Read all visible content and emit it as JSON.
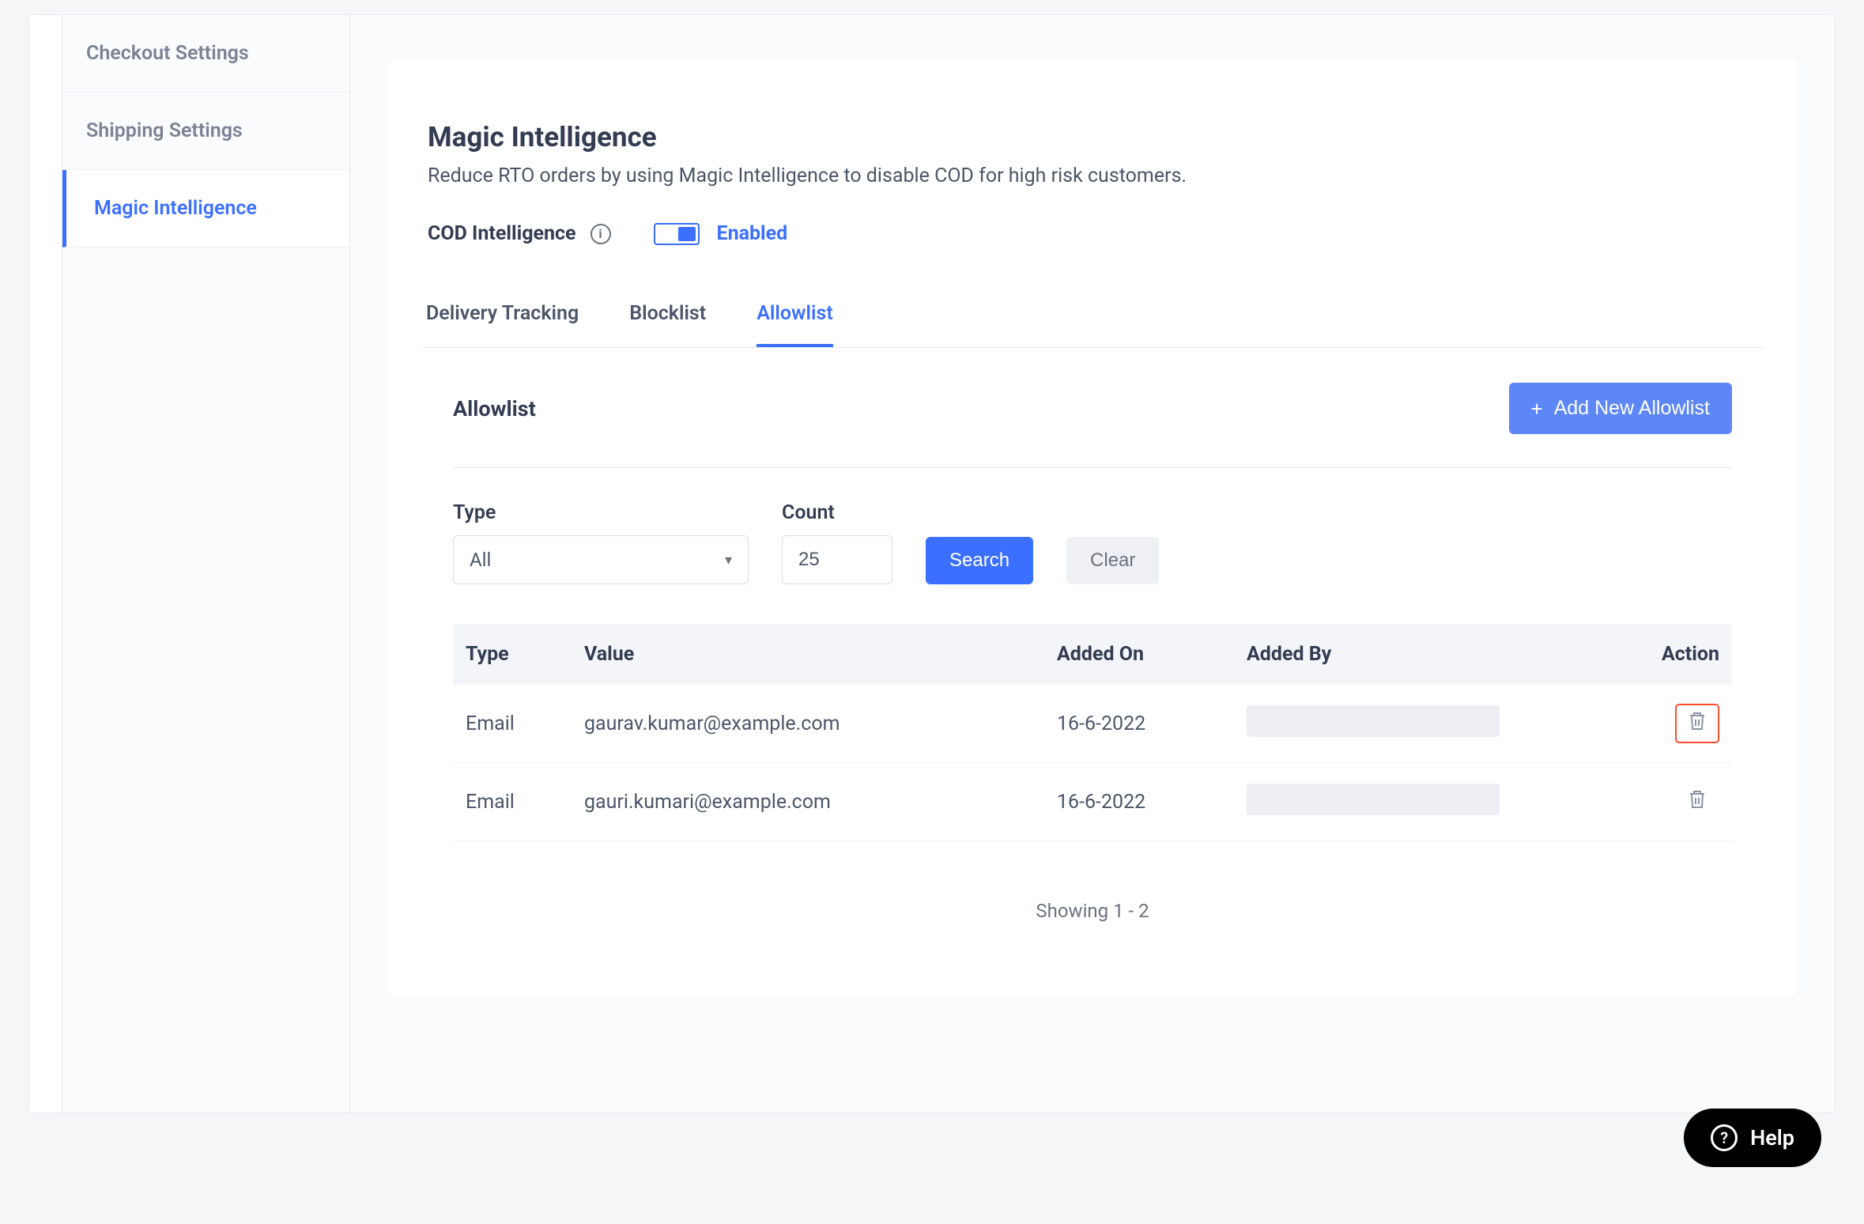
{
  "sidebar": {
    "items": [
      {
        "label": "Checkout Settings"
      },
      {
        "label": "Shipping Settings"
      },
      {
        "label": "Magic Intelligence"
      }
    ]
  },
  "page": {
    "title": "Magic Intelligence",
    "description": "Reduce RTO orders by using Magic Intelligence to disable COD for high risk customers."
  },
  "cod": {
    "label": "COD Intelligence",
    "status": "Enabled"
  },
  "tabs": [
    {
      "label": "Delivery Tracking"
    },
    {
      "label": "Blocklist"
    },
    {
      "label": "Allowlist"
    }
  ],
  "section": {
    "title": "Allowlist",
    "add_button": "Add New Allowlist"
  },
  "filters": {
    "type_label": "Type",
    "type_value": "All",
    "count_label": "Count",
    "count_value": "25",
    "search": "Search",
    "clear": "Clear"
  },
  "table": {
    "headers": {
      "type": "Type",
      "value": "Value",
      "added_on": "Added On",
      "added_by": "Added By",
      "action": "Action"
    },
    "rows": [
      {
        "type": "Email",
        "value": "gaurav.kumar@example.com",
        "added_on": "16-6-2022"
      },
      {
        "type": "Email",
        "value": "gauri.kumari@example.com",
        "added_on": "16-6-2022"
      }
    ],
    "pagination": "Showing 1 - 2"
  },
  "help": {
    "label": "Help"
  }
}
